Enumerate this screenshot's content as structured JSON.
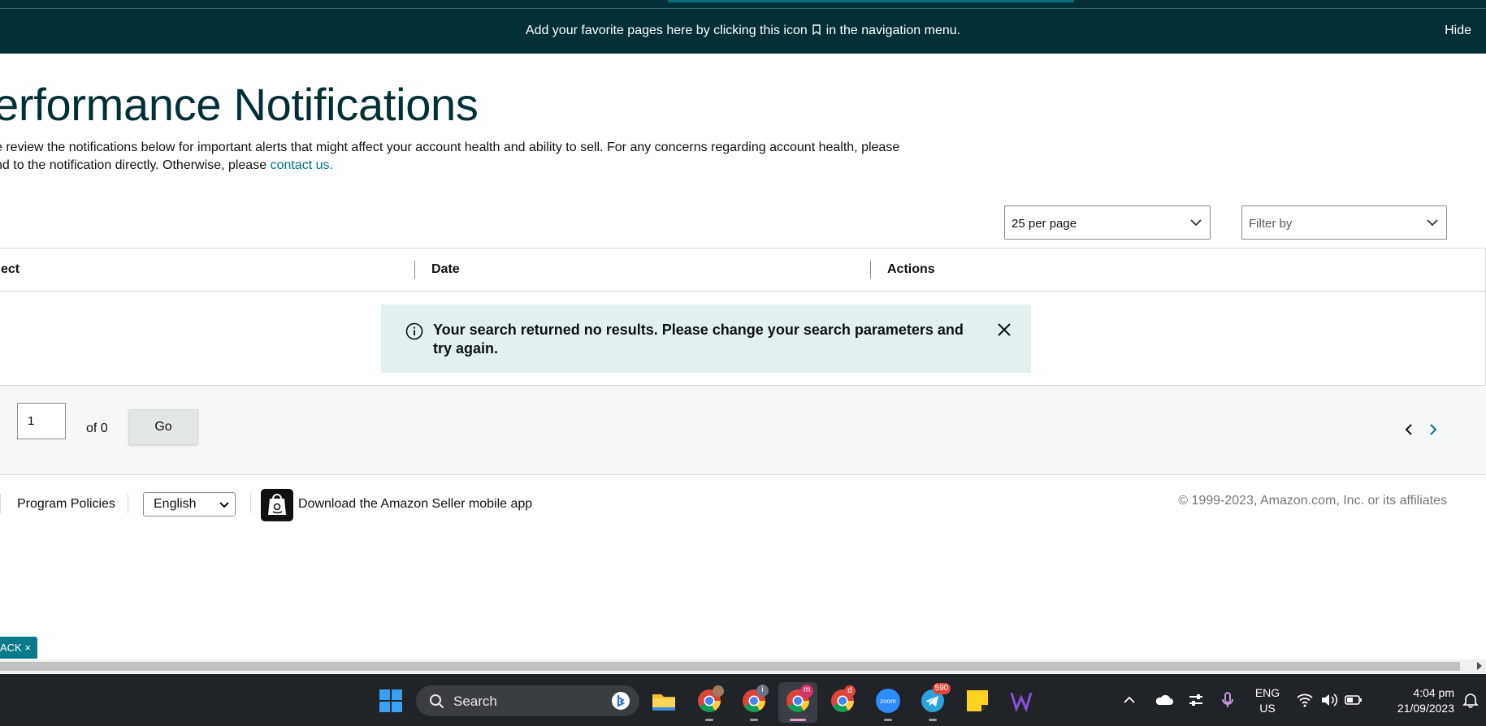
{
  "banner": {
    "message_before": "Add your favorite pages here by clicking this icon",
    "message_after": "in the navigation menu.",
    "hide_label": "Hide"
  },
  "page": {
    "title": "erformance Notifications",
    "description_line1": "e review the notifications below for important alerts that might affect your account health and ability to sell. For any concerns regarding account health, please",
    "description_line2": "nd to the notification directly. Otherwise, please",
    "contact_link": "contact us."
  },
  "controls": {
    "per_page": "25 per page",
    "filter_placeholder": "Filter by"
  },
  "table": {
    "columns": [
      "ect",
      "Date",
      "Actions"
    ],
    "alert_message": "Your search returned no results. Please change your search parameters and try again."
  },
  "pagination": {
    "current_page": "1",
    "of_text": "of 0",
    "go_label": "Go"
  },
  "footer": {
    "program_policies": "Program Policies",
    "language": "English",
    "app_download": "Download the Amazon Seller mobile app",
    "copyright": "© 1999-2023, Amazon.com, Inc. or its affiliates"
  },
  "feedback": {
    "label": "ACK ×"
  },
  "taskbar": {
    "search_placeholder": "Search",
    "lang_line1": "ENG",
    "lang_line2": "US",
    "time": "4:04 pm",
    "date": "21/09/2023",
    "telegram_badge": "590",
    "chrome_profile_1_badge": "i",
    "chrome_profile_2_badge": "m",
    "chrome_profile_3_badge": "d"
  },
  "colors": {
    "banner_bg": "#002f36",
    "link": "#007185",
    "alert_bg": "#e3f0f0",
    "taskbar_bg": "#202428"
  }
}
